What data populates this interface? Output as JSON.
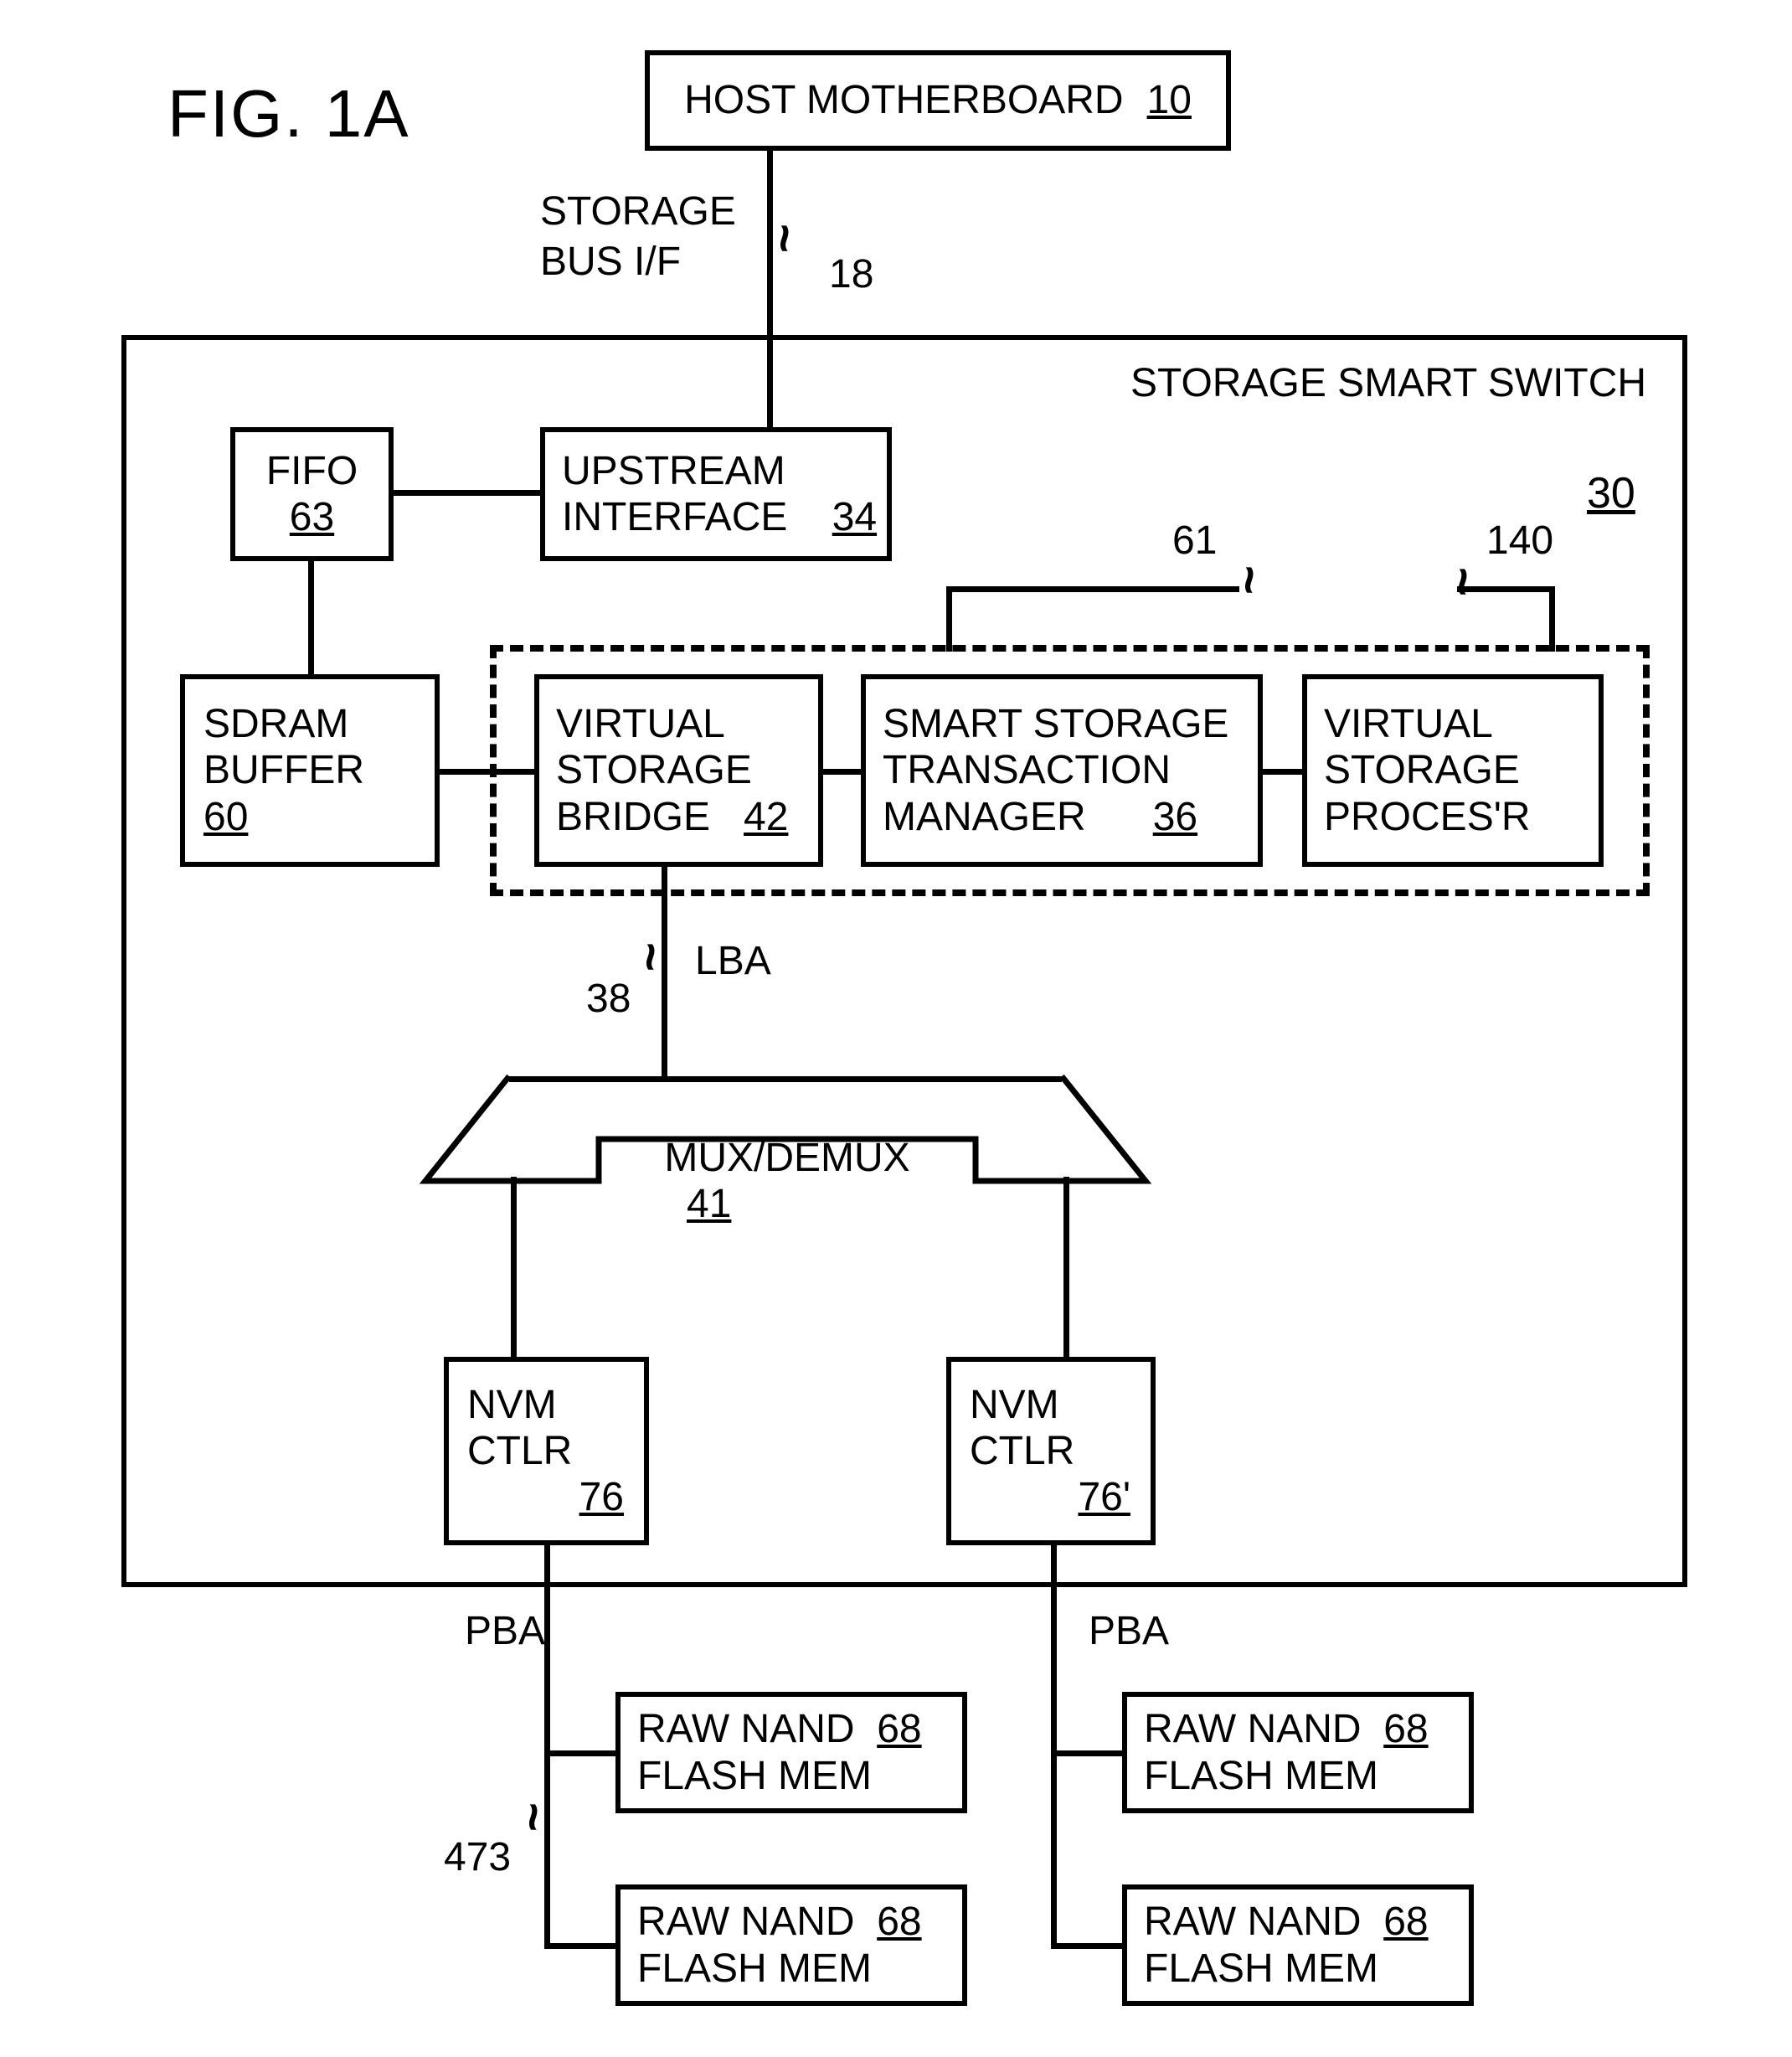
{
  "figure_label": "FIG. 1A",
  "host_motherboard": {
    "text": "HOST MOTHERBOARD",
    "ref": "10"
  },
  "storage_bus_if": {
    "line1": "STORAGE",
    "line2": "BUS I/F",
    "ref": "18"
  },
  "storage_smart_switch": {
    "title": "STORAGE SMART SWITCH",
    "ref": "30"
  },
  "fifo": {
    "text": "FIFO",
    "ref": "63"
  },
  "upstream_interface": {
    "line1": "UPSTREAM",
    "line2": "INTERFACE",
    "ref": "34"
  },
  "sdram_buffer": {
    "line1": "SDRAM",
    "line2": "BUFFER",
    "ref": "60"
  },
  "virtual_storage_bridge": {
    "line1": "VIRTUAL",
    "line2": "STORAGE",
    "line3": "BRIDGE",
    "ref": "42"
  },
  "smart_storage_transaction_manager": {
    "line1": "SMART STORAGE",
    "line2": "TRANSACTION",
    "line3": "MANAGER",
    "ref": "36"
  },
  "virtual_storage_processor": {
    "line1": "VIRTUAL",
    "line2": "STORAGE",
    "line3": "PROCES'R"
  },
  "dashed_group": {
    "ref61": "61",
    "ref140": "140"
  },
  "lba": {
    "text": "LBA",
    "ref": "38"
  },
  "mux_demux": {
    "text": "MUX/DEMUX",
    "ref": "41"
  },
  "nvm_ctlr_left": {
    "line1": "NVM",
    "line2": "CTLR",
    "ref": "76"
  },
  "nvm_ctlr_right": {
    "line1": "NVM",
    "line2": "CTLR",
    "ref": "76'"
  },
  "pba_left": "PBA",
  "pba_right": "PBA",
  "ref473": "473",
  "raw_nand_1": {
    "line1": "RAW NAND",
    "line2": "FLASH MEM",
    "ref": "68"
  },
  "raw_nand_2": {
    "line1": "RAW NAND",
    "line2": "FLASH MEM",
    "ref": "68"
  },
  "raw_nand_3": {
    "line1": "RAW NAND",
    "line2": "FLASH MEM",
    "ref": "68"
  },
  "raw_nand_4": {
    "line1": "RAW NAND",
    "line2": "FLASH MEM",
    "ref": "68"
  }
}
